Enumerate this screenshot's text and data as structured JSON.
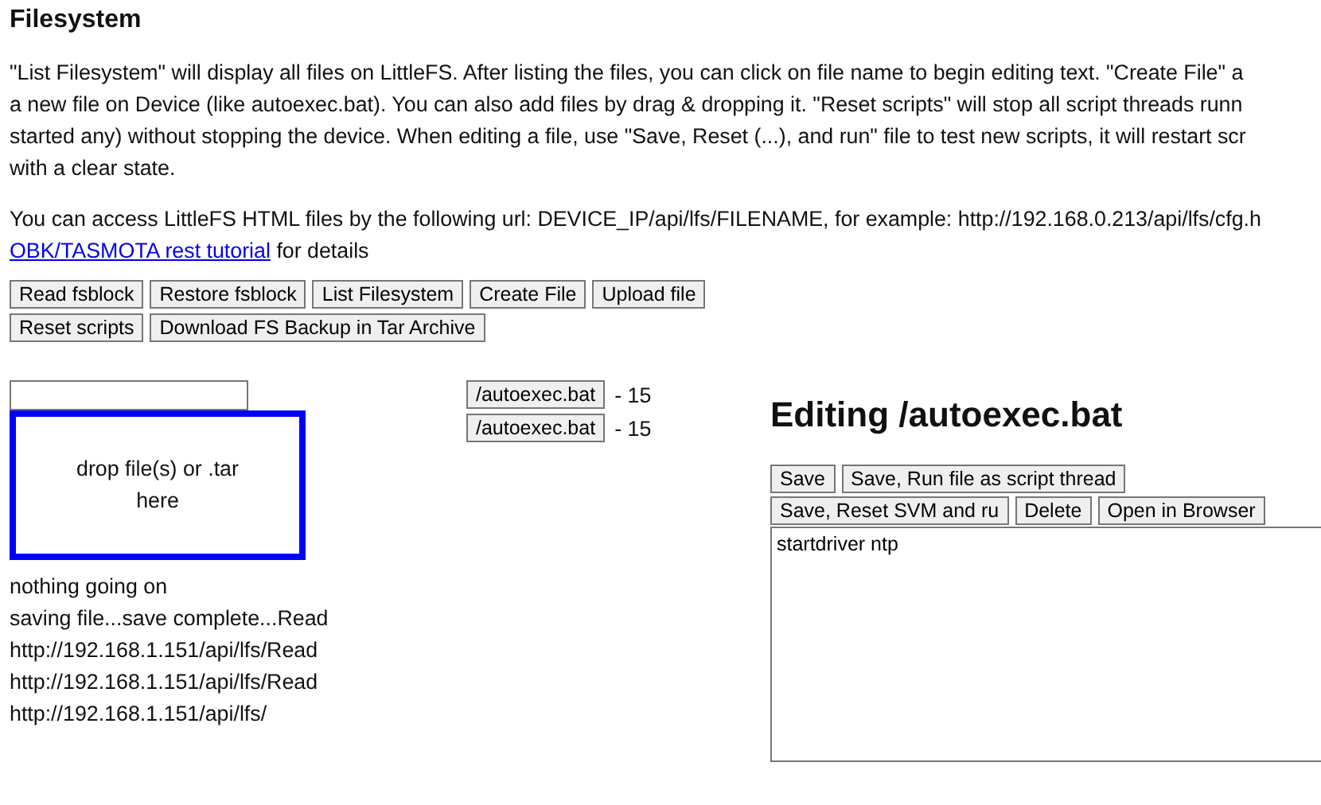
{
  "title": "Filesystem",
  "intro_lines": [
    "\"List Filesystem\" will display all files on LittleFS. After listing the files, you can click on file name to begin editing text. \"Create File\" a",
    "a new file on Device (like autoexec.bat). You can also add files by drag & dropping it. \"Reset scripts\" will stop all script threads runn",
    "started any) without stopping the device. When editing a file, use \"Save, Reset (...), and run\" file to test new scripts, it will restart scr",
    "with a clear state."
  ],
  "access_line": "You can access LittleFS HTML files by the following url: DEVICE_IP/api/lfs/FILENAME, for example: http://192.168.0.213/api/lfs/cfg.h",
  "tutorial_link": "OBK/TASMOTA rest tutorial",
  "tutorial_suffix": "for details",
  "toolbar": [
    "Read fsblock",
    "Restore fsblock",
    "List Filesystem",
    "Create File",
    "Upload file",
    "Reset scripts",
    "Download FS Backup in Tar Archive"
  ],
  "drop_zone": "drop file(s) or .tar here",
  "status_lines": [
    "nothing going on",
    "saving file...save complete...Read",
    "http://192.168.1.151/api/lfs/Read",
    "http://192.168.1.151/api/lfs/Read",
    "http://192.168.1.151/api/lfs/"
  ],
  "files": [
    {
      "name": "/autoexec.bat",
      "size": "- 15"
    },
    {
      "name": "/autoexec.bat",
      "size": "- 15"
    }
  ],
  "editor": {
    "heading": "Editing /autoexec.bat",
    "buttons": [
      "Save",
      "Save, Run file as script thread",
      "Save, Reset SVM and ru",
      "Delete",
      "Open in Browser"
    ],
    "content": "startdriver ntp"
  }
}
